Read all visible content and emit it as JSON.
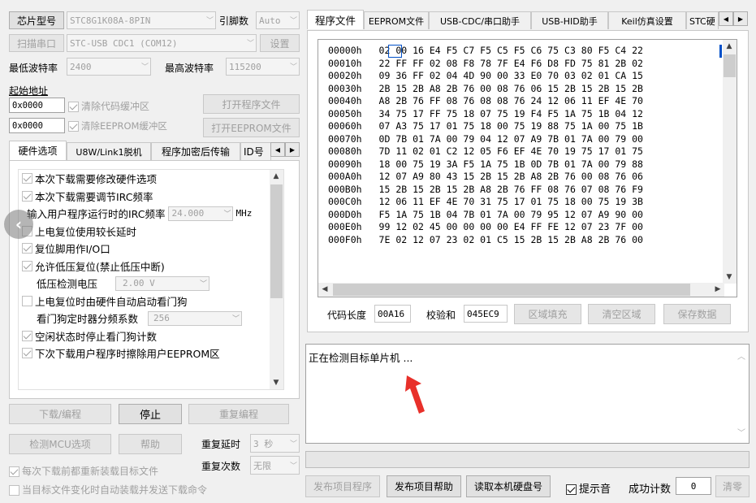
{
  "left": {
    "chip_model_label": "芯片型号",
    "chip_model_value": "STC8G1K08A-8PIN",
    "pin_count_label": "引脚数",
    "pin_count_value": "Auto",
    "scan_port_label": "扫描串口",
    "port_value": "STC-USB CDC1 (COM12)",
    "settings_label": "设置",
    "min_baud_label": "最低波特率",
    "min_baud_value": "2400",
    "max_baud_label": "最高波特率",
    "max_baud_value": "115200",
    "start_addr_label": "起始地址",
    "addr1": "0x0000",
    "clear_code_label": "清除代码缓冲区",
    "open_program_label": "打开程序文件",
    "addr2": "0x0000",
    "clear_eeprom_label": "清除EEPROM缓冲区",
    "open_eeprom_label": "打开EEPROM文件",
    "tabs": [
      "硬件选项",
      "U8W/Link1脱机",
      "程序加密后传输",
      "ID号"
    ],
    "options": [
      "本次下载需要修改硬件选项",
      "本次下载需要调节IRC频率",
      "输入用户程序运行时的IRC频率",
      "上电复位使用较长延时",
      "复位脚用作I/O口",
      "允许低压复位(禁止低压中断)",
      "低压检测电压",
      "上电复位时由硬件自动启动看门狗",
      "看门狗定时器分频系数",
      "空闲状态时停止看门狗计数",
      "下次下载用户程序时擦除用户EEPROM区"
    ],
    "irc_value": "24.000",
    "irc_unit": "MHz",
    "lvd_value": "2.00 V",
    "wdt_value": "256",
    "download_label": "下载/编程",
    "stop_label": "停止",
    "repeat_prog_label": "重复编程",
    "detect_mcu_label": "检测MCU选项",
    "help_label": "帮助",
    "repeat_delay_label": "重复延时",
    "repeat_delay_value": "3 秒",
    "repeat_count_label": "重复次数",
    "repeat_count_value": "无限",
    "reload_label": "每次下载前都重新装载目标文件",
    "autoload_label": "当目标文件变化时自动装载并发送下载命令"
  },
  "right": {
    "tabs": [
      "程序文件",
      "EEPROM文件",
      "USB-CDC/串口助手",
      "USB-HID助手",
      "Keil仿真设置",
      "STC硬"
    ],
    "hex_rows": [
      {
        "addr": "00000h",
        "bytes": "02 00 16 E4 F5 C7 F5 C5 F5 C6 75 C3 80 F5 C4 22"
      },
      {
        "addr": "00010h",
        "bytes": "22 FF FF 02 08 F8 78 7F E4 F6 D8 FD 75 81 2B 02"
      },
      {
        "addr": "00020h",
        "bytes": "09 36 FF 02 04 4D 90 00 33 E0 70 03 02 01 CA 15"
      },
      {
        "addr": "00030h",
        "bytes": "2B 15 2B A8 2B 76 00 08 76 06 15 2B 15 2B 15 2B"
      },
      {
        "addr": "00040h",
        "bytes": "A8 2B 76 FF 08 76 08 08 76 24 12 06 11 EF 4E 70"
      },
      {
        "addr": "00050h",
        "bytes": "34 75 17 FF 75 18 07 75 19 F4 F5 1A 75 1B 04 12"
      },
      {
        "addr": "00060h",
        "bytes": "07 A3 75 17 01 75 18 00 75 19 88 75 1A 00 75 1B"
      },
      {
        "addr": "00070h",
        "bytes": "0D 7B 01 7A 00 79 04 12 07 A9 7B 01 7A 00 79 00"
      },
      {
        "addr": "00080h",
        "bytes": "7D 11 02 01 C2 12 05 F6 EF 4E 70 19 75 17 01 75"
      },
      {
        "addr": "00090h",
        "bytes": "18 00 75 19 3A F5 1A 75 1B 0D 7B 01 7A 00 79 88"
      },
      {
        "addr": "000A0h",
        "bytes": "12 07 A9 80 43 15 2B 15 2B A8 2B 76 00 08 76 06"
      },
      {
        "addr": "000B0h",
        "bytes": "15 2B 15 2B 15 2B A8 2B 76 FF 08 76 07 08 76 F9"
      },
      {
        "addr": "000C0h",
        "bytes": "12 06 11 EF 4E 70 31 75 17 01 75 18 00 75 19 3B"
      },
      {
        "addr": "000D0h",
        "bytes": "F5 1A 75 1B 04 7B 01 7A 00 79 95 12 07 A9 90 00"
      },
      {
        "addr": "000E0h",
        "bytes": "99 12 02 45 00 00 00 00 E4 FF FE 12 07 23 7F 00"
      },
      {
        "addr": "000F0h",
        "bytes": "7E 02 12 07 23 02 01 C5 15 2B 15 2B A8 2B 76 00"
      }
    ],
    "code_len_label": "代码长度",
    "code_len_value": "00A16",
    "checksum_label": "校验和",
    "checksum_value": "045EC9",
    "fill_label": "区域填充",
    "clear_label": "清空区域",
    "save_label": "保存数据",
    "status_text": "正在检测目标单片机 ...",
    "publish_prog_label": "发布项目程序",
    "publish_help_label": "发布项目帮助",
    "read_disk_label": "读取本机硬盘号",
    "beep_label": "提示音",
    "success_label": "成功计数",
    "success_value": "0",
    "clear_count_label": "清零"
  },
  "colors": {
    "accent_red": "#e8302a",
    "cursor_blue": "#0050c8"
  }
}
